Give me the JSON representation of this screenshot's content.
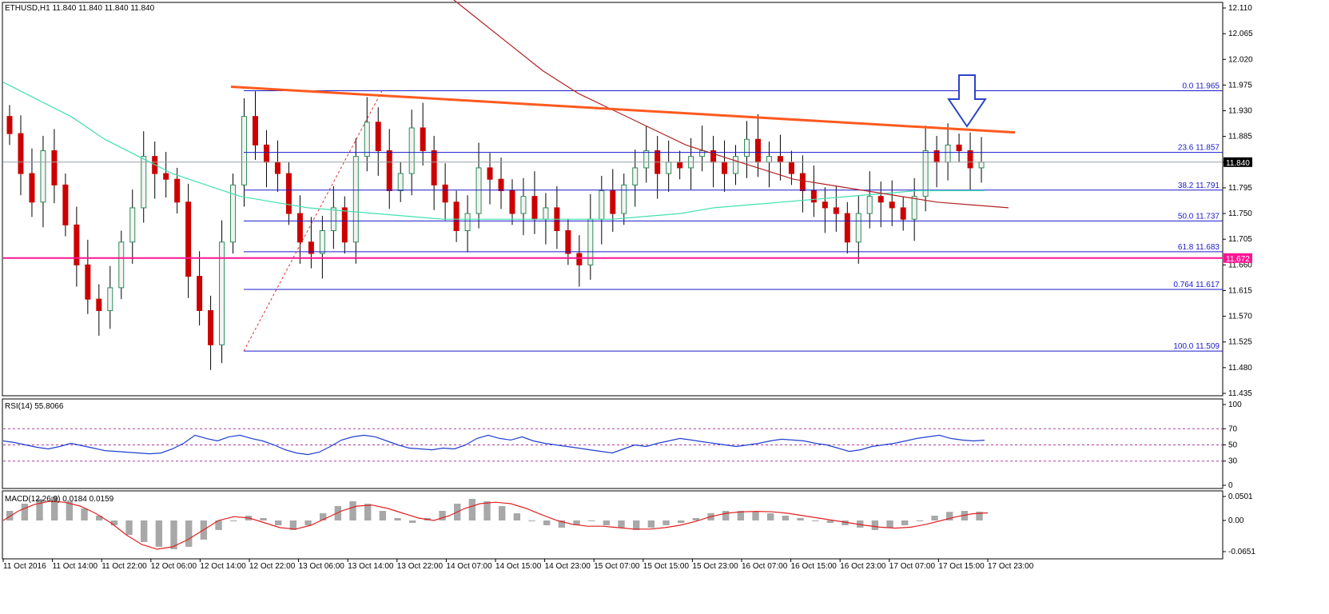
{
  "chart_data": [
    {
      "type": "candlestick",
      "panel": "price",
      "title": "ETHUSD,H1 11.840 11.840 11.840 11.840",
      "yticks": [
        "12.110",
        "12.065",
        "12.020",
        "11.975",
        "11.930",
        "11.885",
        "11.840",
        "11.795",
        "11.750",
        "11.705",
        "11.660",
        "11.615",
        "11.570",
        "11.525",
        "11.480",
        "11.435"
      ],
      "ylim": [
        11.435,
        12.11
      ],
      "current_price": "11.840",
      "support_label": "11.672",
      "fib_levels": [
        {
          "ratio": "0.0",
          "value": "11.965"
        },
        {
          "ratio": "23.6",
          "value": "11.857"
        },
        {
          "ratio": "38.2",
          "value": "11.791"
        },
        {
          "ratio": "50.0",
          "value": "11.737"
        },
        {
          "ratio": "61.8",
          "value": "11.683"
        },
        {
          "ratio": "0.764",
          "value": "11.617"
        },
        {
          "ratio": "100.0",
          "value": "11.509"
        }
      ],
      "x": [
        "11 Oct 2016",
        "11 Oct 14:00",
        "11 Oct 22:00",
        "12 Oct 06:00",
        "12 Oct 14:00",
        "12 Oct 22:00",
        "13 Oct 06:00",
        "13 Oct 14:00",
        "13 Oct 22:00",
        "14 Oct 07:00",
        "14 Oct 15:00",
        "14 Oct 23:00",
        "15 Oct 07:00",
        "15 Oct 15:00",
        "15 Oct 23:00",
        "16 Oct 07:00",
        "16 Oct 15:00",
        "16 Oct 23:00",
        "17 Oct 07:00",
        "17 Oct 15:00",
        "17 Oct 23:00"
      ],
      "close": [
        11.89,
        11.82,
        11.77,
        11.86,
        11.8,
        11.73,
        11.66,
        11.6,
        11.58,
        11.62,
        11.7,
        11.76,
        11.85,
        11.82,
        11.81,
        11.77,
        11.64,
        11.58,
        11.52,
        11.7,
        11.8,
        11.92,
        11.87,
        11.84,
        11.82,
        11.75,
        11.7,
        11.68,
        11.72,
        11.76,
        11.7,
        11.85,
        11.91,
        11.86,
        11.79,
        11.82,
        11.9,
        11.86,
        11.8,
        11.77,
        11.72,
        11.75,
        11.83,
        11.81,
        11.79,
        11.75,
        11.78,
        11.74,
        11.76,
        11.72,
        11.68,
        11.66,
        11.74,
        11.79,
        11.75,
        11.8,
        11.83,
        11.86,
        11.82,
        11.84,
        11.83,
        11.85,
        11.86,
        11.84,
        11.82,
        11.85,
        11.88,
        11.84,
        11.85,
        11.84,
        11.82,
        11.79,
        11.77,
        11.76,
        11.75,
        11.7,
        11.75,
        11.78,
        11.77,
        11.76,
        11.74,
        11.78,
        11.86,
        11.84,
        11.87,
        11.86,
        11.83,
        11.84
      ],
      "ma_fast": [
        11.98,
        11.95,
        11.92,
        11.88,
        11.85,
        11.82,
        11.8,
        11.78,
        11.77,
        11.76,
        11.755,
        11.75,
        11.745,
        11.74,
        11.74,
        11.74,
        11.74,
        11.74,
        11.74,
        11.745,
        11.75,
        11.76,
        11.765,
        11.77,
        11.775,
        11.78,
        11.785,
        11.79,
        11.79,
        11.79
      ],
      "ma_slow": [
        12.25,
        12.2,
        12.15,
        12.1,
        12.05,
        12.0,
        11.96,
        11.93,
        11.9,
        11.87,
        11.85,
        11.83,
        11.81,
        11.8,
        11.79,
        11.78,
        11.77,
        11.765,
        11.76
      ],
      "resistance_label": "",
      "arrow_marker": "down-arrow"
    },
    {
      "type": "line",
      "panel": "rsi",
      "title": "RSI(14) 55.8066",
      "yticks": [
        "100",
        "70",
        "50",
        "30",
        "0"
      ],
      "ylim": [
        0,
        100
      ],
      "levels": [
        70,
        50,
        30
      ],
      "values": [
        55,
        53,
        50,
        47,
        45,
        48,
        52,
        49,
        46,
        43,
        42,
        41,
        40,
        39,
        40,
        45,
        52,
        62,
        58,
        55,
        60,
        62,
        58,
        55,
        50,
        44,
        40,
        38,
        41,
        48,
        56,
        60,
        62,
        60,
        55,
        50,
        46,
        45,
        44,
        46,
        45,
        50,
        58,
        62,
        58,
        56,
        60,
        55,
        52,
        50,
        48,
        46,
        44,
        42,
        40,
        45,
        50,
        48,
        52,
        55,
        58,
        56,
        54,
        52,
        50,
        48,
        50,
        52,
        55,
        57,
        56,
        55,
        52,
        50,
        46,
        42,
        44,
        48,
        50,
        52,
        55,
        58,
        60,
        62,
        58,
        56,
        55,
        55.8
      ]
    },
    {
      "type": "bar",
      "panel": "macd",
      "title": "MACD(12,26,9) 0.0184 0.0159",
      "yticks": [
        "0.0501",
        "0.00",
        "-0.0651"
      ],
      "ylim": [
        -0.0651,
        0.0501
      ],
      "histogram": [
        0.02,
        0.035,
        0.045,
        0.05,
        0.04,
        0.025,
        0.01,
        -0.01,
        -0.03,
        -0.045,
        -0.055,
        -0.06,
        -0.055,
        -0.04,
        -0.02,
        0.0,
        0.01,
        0.005,
        -0.01,
        -0.02,
        -0.01,
        0.015,
        0.03,
        0.04,
        0.035,
        0.02,
        0.005,
        -0.005,
        0.005,
        0.02,
        0.035,
        0.045,
        0.04,
        0.03,
        0.015,
        0.0,
        -0.01,
        -0.015,
        -0.01,
        0.0,
        -0.01,
        -0.015,
        -0.02,
        -0.015,
        -0.01,
        -0.005,
        0.005,
        0.015,
        0.02,
        0.02,
        0.018,
        0.015,
        0.01,
        0.005,
        0.0,
        -0.005,
        -0.01,
        -0.015,
        -0.02,
        -0.015,
        -0.01,
        0.0,
        0.01,
        0.018,
        0.02,
        0.0184
      ],
      "signal": [
        0.0,
        0.02,
        0.033,
        0.04,
        0.038,
        0.03,
        0.015,
        -0.005,
        -0.03,
        -0.05,
        -0.06,
        -0.055,
        -0.04,
        -0.02,
        0.0,
        0.008,
        0.005,
        -0.005,
        -0.015,
        -0.018,
        -0.01,
        0.005,
        0.02,
        0.03,
        0.032,
        0.025,
        0.015,
        0.005,
        0.0,
        0.01,
        0.025,
        0.035,
        0.038,
        0.035,
        0.025,
        0.012,
        0.0,
        -0.008,
        -0.012,
        -0.012,
        -0.015,
        -0.018,
        -0.018,
        -0.015,
        -0.01,
        -0.002,
        0.008,
        0.015,
        0.018,
        0.019,
        0.018,
        0.015,
        0.01,
        0.005,
        0.0,
        -0.005,
        -0.01,
        -0.014,
        -0.016,
        -0.014,
        -0.008,
        0.0,
        0.008,
        0.014,
        0.0159
      ]
    }
  ]
}
